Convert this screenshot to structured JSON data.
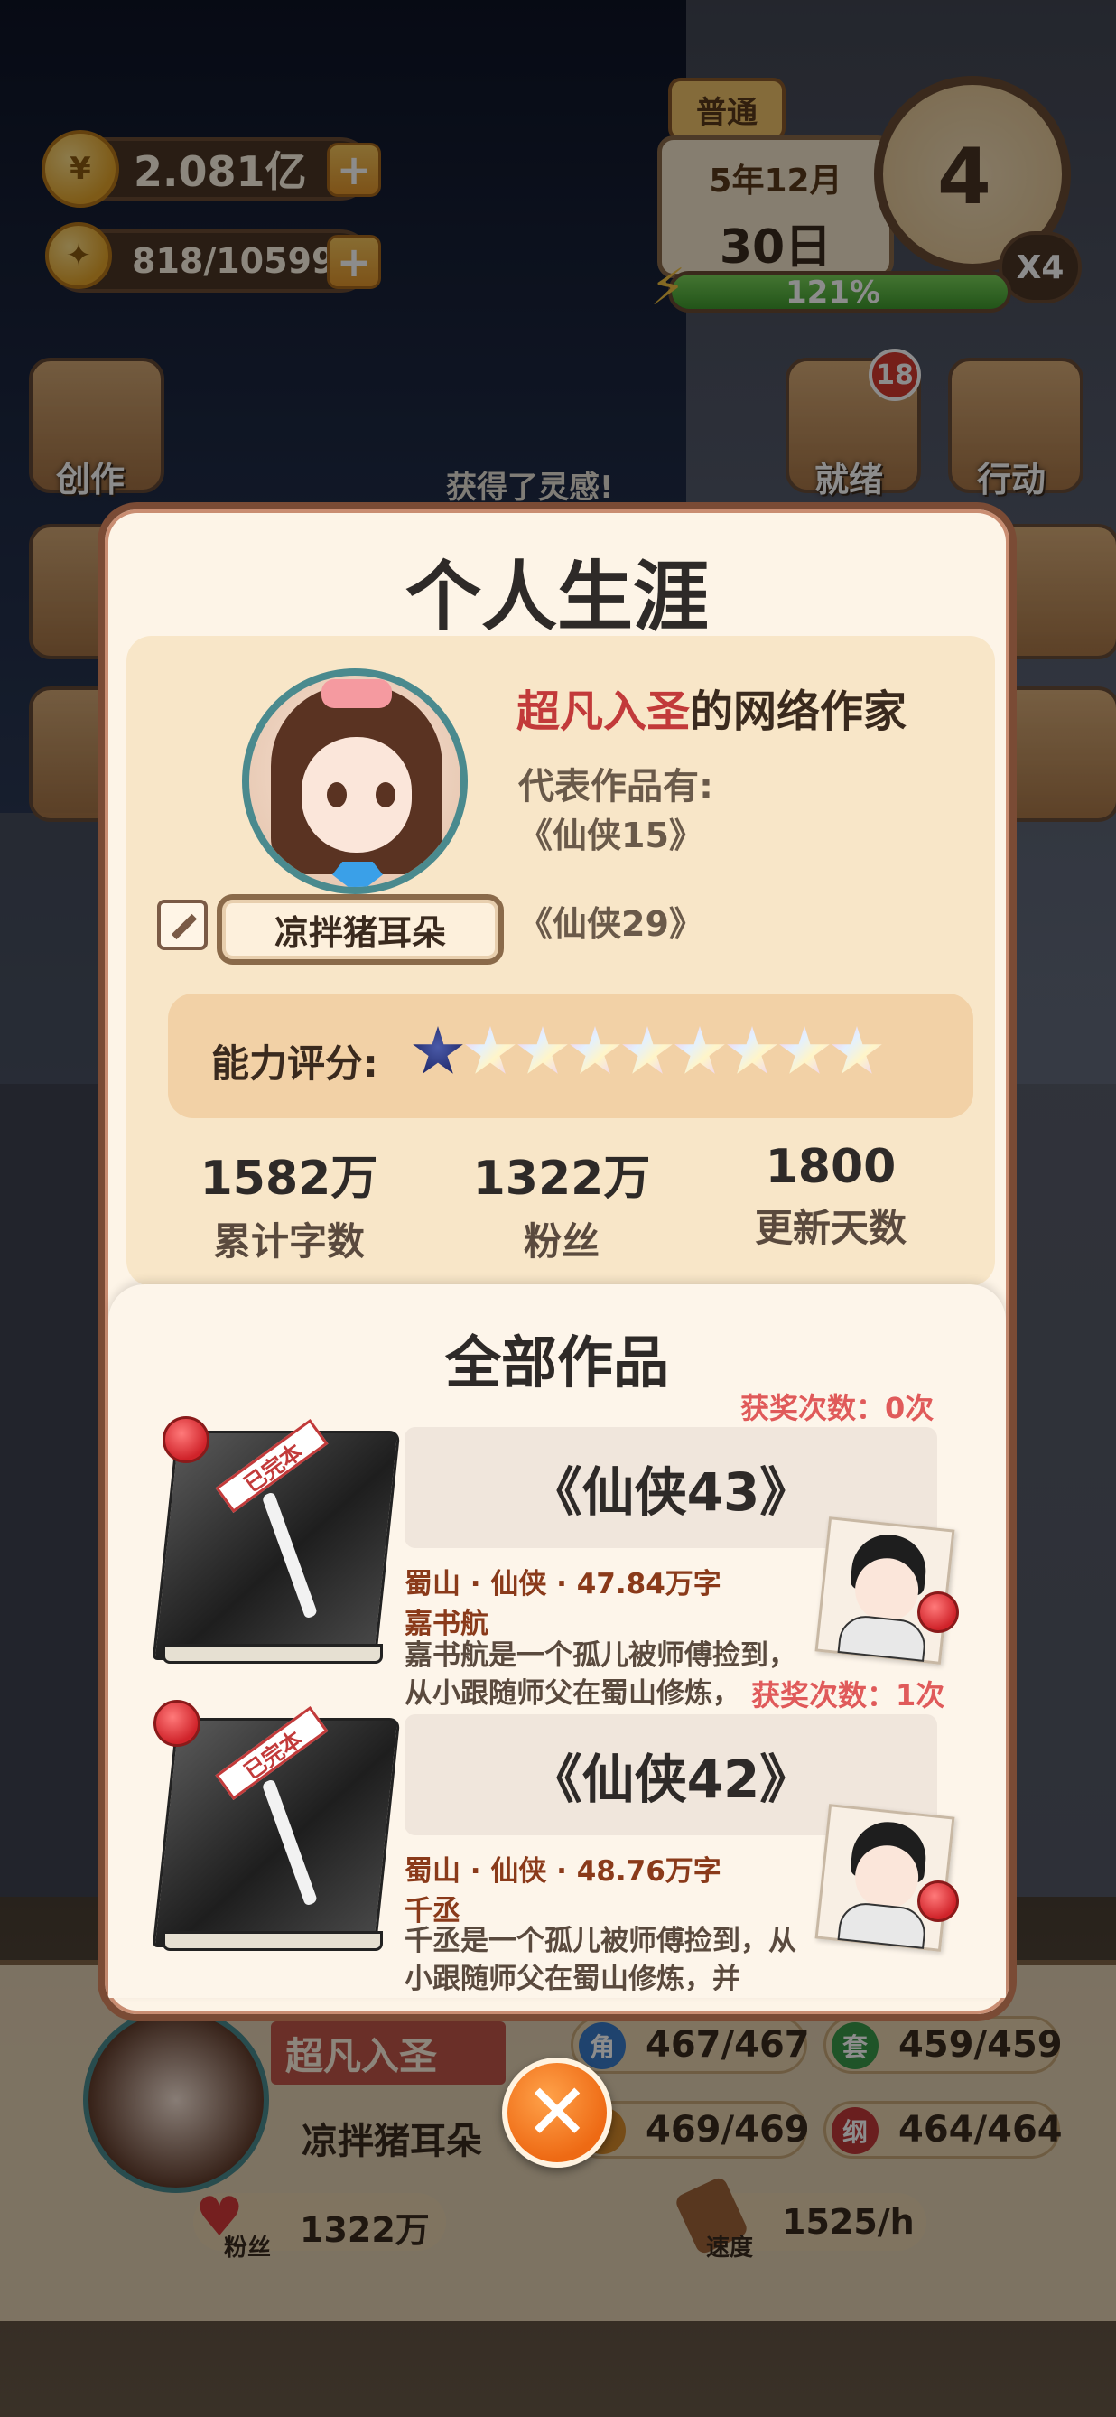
{
  "hud": {
    "gold": "2.081亿",
    "inspiration": "818/10599",
    "mode_tag": "普通",
    "date_month": "5年12月",
    "date_day": "30日",
    "clock_hour": "4",
    "speed": "X4",
    "energy_percent": 121,
    "energy_label": "121%",
    "inspiration_toast": "获得了灵感!"
  },
  "side_buttons": {
    "create": "创作",
    "ready": "就绪",
    "ready_badge": "18",
    "action": "行动"
  },
  "modal": {
    "title": "个人生涯",
    "profile": {
      "rank": "超凡入圣",
      "author_suffix": "的网络作家",
      "works_label": "代表作品有:",
      "works": [
        "《仙侠15》",
        "《仙侠29》"
      ],
      "name": "凉拌猪耳朵",
      "rating_label": "能力评分:",
      "rating_stars_filled": 1,
      "rating_stars_total": 9
    },
    "stats": [
      {
        "value": "1582万",
        "label": "累计字数"
      },
      {
        "value": "1322万",
        "label": "粉丝"
      },
      {
        "value": "1800",
        "label": "更新天数"
      }
    ],
    "works_title": "全部作品",
    "works_list": [
      {
        "title": "《仙侠43》",
        "awards": "获奖次数：0次",
        "meta": "蜀山 · 仙侠 · 47.84万字",
        "protagonist": "嘉书航",
        "desc": "嘉书航是一个孤儿被师傅捡到，从小跟随师父在蜀山修炼，",
        "status": "已完本"
      },
      {
        "title": "《仙侠42》",
        "awards": "获奖次数：1次",
        "meta": "蜀山 · 仙侠 · 48.76万字",
        "protagonist": "千丞",
        "desc": "千丞是一个孤儿被师傅捡到，从小跟随师父在蜀山修炼，并",
        "status": "已完本"
      }
    ]
  },
  "bottom": {
    "rank": "超凡入圣",
    "name": "凉拌猪耳朵",
    "role_stat": "467/467",
    "set_stat": "459/459",
    "stat3": "469/469",
    "outline_stat": "464/464",
    "role_icon": "角",
    "set_icon": "套",
    "outline_icon": "纲",
    "fans_label": "粉丝",
    "fans": "1322万",
    "speed_label": "速度",
    "speed": "1525/h"
  },
  "colors": {
    "modal_border": "#7a4b35",
    "rank_red": "#c23a3a",
    "award_red": "#e05a5a",
    "close_orange": "#ee6a14"
  }
}
